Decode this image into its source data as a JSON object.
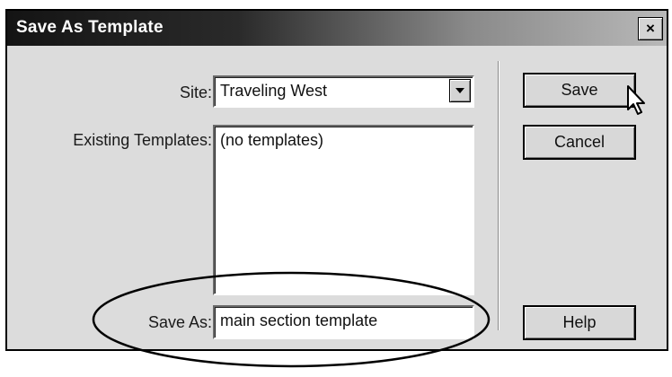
{
  "dialog": {
    "title": "Save As Template",
    "close_glyph": "×"
  },
  "form": {
    "site_label": "Site:",
    "site_value": "Traveling West",
    "existing_label": "Existing Templates:",
    "existing_items": [
      "(no templates)"
    ],
    "save_as_label": "Save As:",
    "save_as_value": "main section template"
  },
  "buttons": {
    "save": "Save",
    "cancel": "Cancel",
    "help": "Help"
  },
  "icons": {
    "dropdown": "chevron-down-icon",
    "close": "close-icon",
    "cursor": "mouse-pointer-icon"
  }
}
